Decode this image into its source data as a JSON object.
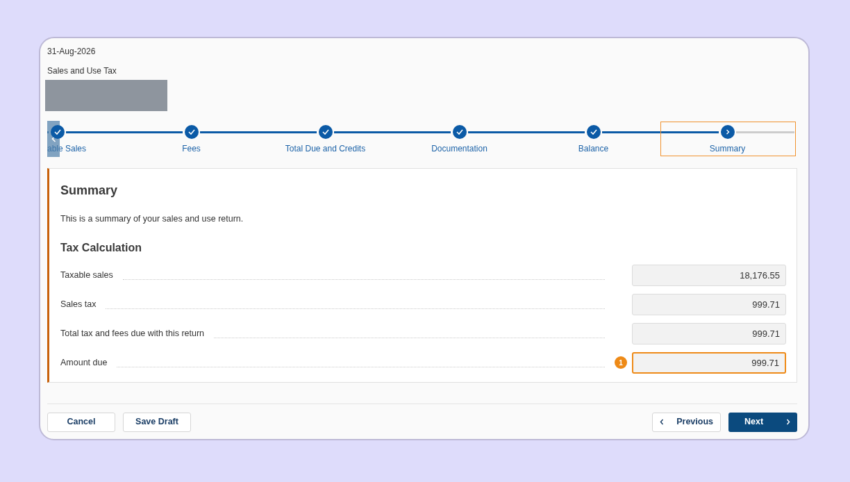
{
  "header": {
    "date": "31-Aug-2026",
    "tax_type": "Sales and Use Tax"
  },
  "steps": [
    {
      "label": "able Sales",
      "done": true,
      "highlighted": false
    },
    {
      "label": "Fees",
      "done": true,
      "highlighted": false
    },
    {
      "label": "Total Due and Credits",
      "done": true,
      "highlighted": false
    },
    {
      "label": "Documentation",
      "done": true,
      "highlighted": false
    },
    {
      "label": "Balance",
      "done": true,
      "highlighted": false
    },
    {
      "label": "Summary",
      "done": false,
      "highlighted": true
    }
  ],
  "panel": {
    "title": "Summary",
    "description": "This is a summary of your sales and use return.",
    "section_title": "Tax Calculation",
    "rows": [
      {
        "label": "Taxable sales",
        "value": "18,176.55",
        "highlighted": false
      },
      {
        "label": "Sales tax",
        "value": "999.71",
        "highlighted": false
      },
      {
        "label": "Total tax and fees due with this return",
        "value": "999.71",
        "highlighted": false
      },
      {
        "label": "Amount due",
        "value": "999.71",
        "highlighted": true,
        "badge": "1"
      }
    ]
  },
  "buttons": {
    "cancel": "Cancel",
    "save_draft": "Save Draft",
    "previous": "Previous",
    "next": "Next"
  }
}
